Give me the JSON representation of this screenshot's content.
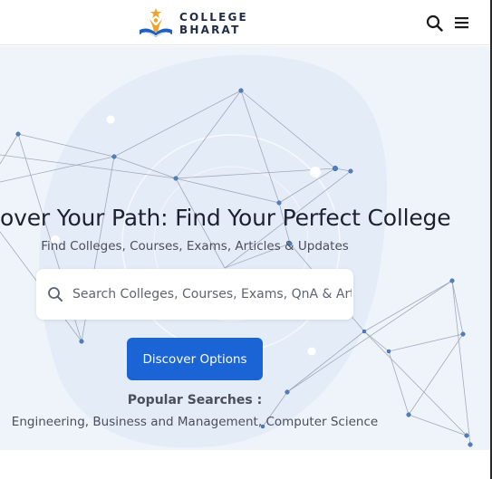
{
  "header": {
    "logo_line1": "COLLEGE",
    "logo_line2": "BHARAT",
    "logo_icon": "graduate-book-logo",
    "search_icon": "search-icon",
    "menu_icon": "hamburger-menu-icon"
  },
  "hero": {
    "title": "over Your Path: Find Your Perfect College",
    "subtitle": "Find Colleges, Courses, Exams, Articles & Updates",
    "search": {
      "placeholder": "Search Colleges, Courses, Exams, QnA & Art",
      "value": ""
    },
    "cta_label": "Discover Options",
    "popular_title": "Popular Searches :",
    "popular_links": [
      "Engineering",
      "Business and Management",
      "Computer Science"
    ]
  },
  "colors": {
    "accent": "#1a64d6",
    "brand_orange": "#f2a229",
    "brand_navy": "#1f2a44",
    "hero_bg": "#eff4fb"
  }
}
